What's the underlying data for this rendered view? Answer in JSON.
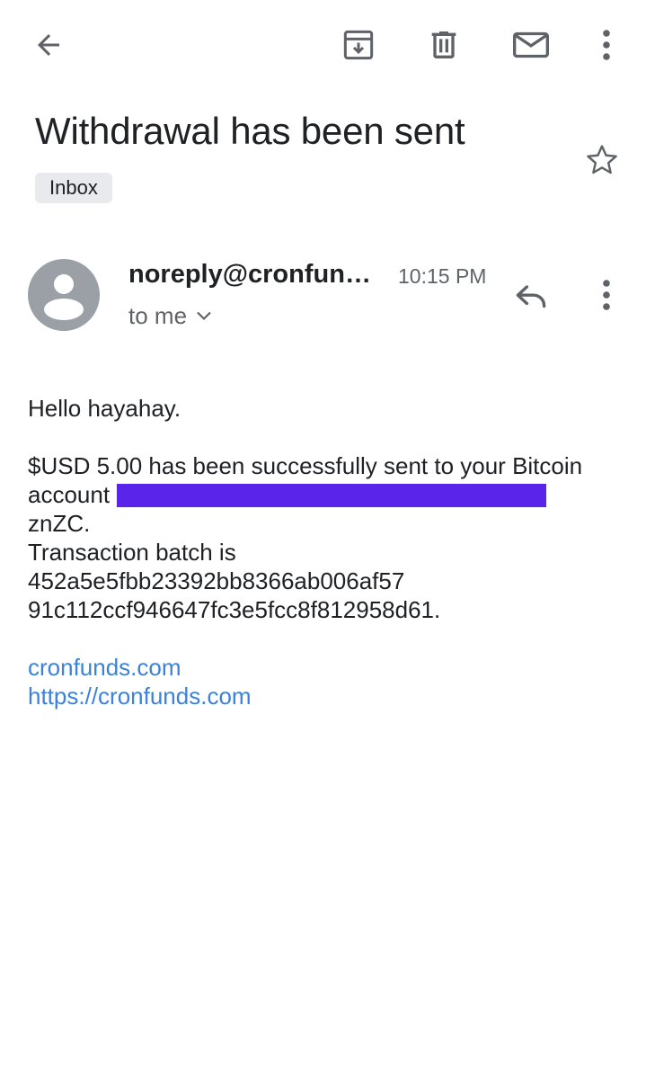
{
  "toolbar": {
    "back_icon": "arrow-left-icon",
    "archive_icon": "archive-icon",
    "delete_icon": "trash-icon",
    "mark_unread_icon": "mail-icon",
    "more_icon": "more-vert-icon"
  },
  "email": {
    "subject": "Withdrawal has been sent",
    "label": "Inbox",
    "star_icon": "star-outline-icon",
    "sender": "noreply@cronfun…",
    "time": "10:15 PM",
    "recipient": "to me",
    "recipient_expand_icon": "chevron-down-icon",
    "reply_icon": "reply-icon",
    "message_more_icon": "more-vert-icon"
  },
  "body": {
    "greeting": "Hello hayahay.",
    "line1": "$USD 5.00 has been successfully sent to your Bitcoin",
    "line2_prefix": "account",
    "line3": "znZC.",
    "line4": "Transaction batch is",
    "line5": "452a5e5fbb23392bb8366ab006af57",
    "line6": "91c112ccf946647fc3e5fcc8f812958d61.",
    "link1": "cronfunds.com",
    "link2": "https://cronfunds.com"
  },
  "colors": {
    "redaction": "#5b24ea",
    "link": "#3b82d8",
    "avatar": "#9aa0a6",
    "chip": "#e8eaed"
  }
}
